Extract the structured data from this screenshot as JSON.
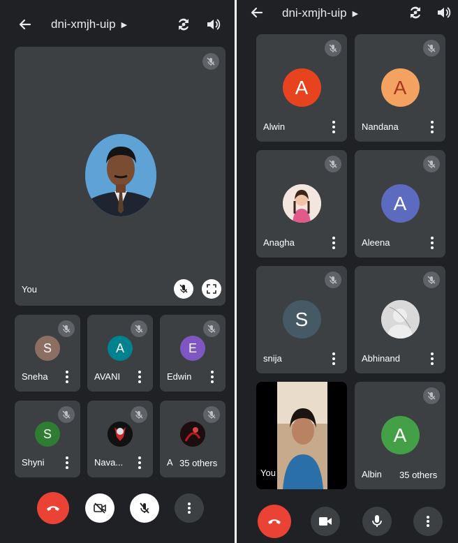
{
  "left": {
    "meeting_code": "dni-xmjh-uip",
    "self_label": "You",
    "participants": [
      {
        "name": "Sneha",
        "initial": "S",
        "color": "#8d6e63"
      },
      {
        "name": "AVANI",
        "initial": "A",
        "color": "#00838f"
      },
      {
        "name": "Edwin",
        "initial": "E",
        "color": "#7e57c2"
      },
      {
        "name": "Shyni",
        "initial": "S",
        "color": "#2e7d32"
      },
      {
        "name": "Nava...",
        "initial": "",
        "color": "#1a1a1a"
      },
      {
        "name": "A",
        "initial": "",
        "color": "#2a1a1a"
      }
    ],
    "others_label": "35 others"
  },
  "right": {
    "meeting_code": "dni-xmjh-uip",
    "participants": [
      {
        "name": "Alwin",
        "initial": "A",
        "color": "#e8431f"
      },
      {
        "name": "Nandana",
        "initial": "A",
        "color": "#f4a261",
        "text_color": "#a4391a"
      },
      {
        "name": "Anagha",
        "initial": "",
        "color": "#f1e4dc"
      },
      {
        "name": "Aleena",
        "initial": "A",
        "color": "#5c6bc0"
      },
      {
        "name": "snija",
        "initial": "S",
        "color": "#455a64"
      },
      {
        "name": "Abhinand",
        "initial": "",
        "color": "#bdbdbd"
      },
      {
        "name": "You",
        "initial": "",
        "color": "#c9a98a"
      },
      {
        "name": "Albin",
        "initial": "A",
        "color": "#43a047"
      }
    ],
    "others_label": "35 others"
  },
  "colors": {
    "background": "#202124",
    "tile": "#3c4043",
    "end_call": "#ea4335"
  }
}
